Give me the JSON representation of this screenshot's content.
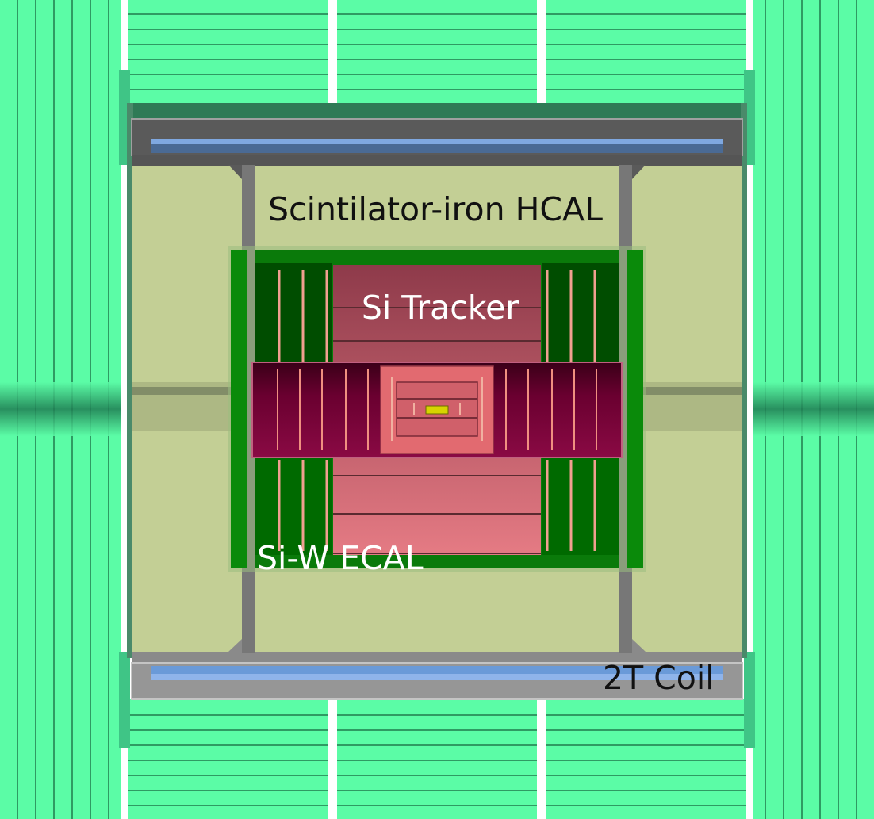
{
  "labels": {
    "hcal": "Scintilator-iron HCAL",
    "tracker": "Si Tracker",
    "ecal": "Si-W ECAL",
    "coil": "2T Coil"
  },
  "colors": {
    "muon": "#5bfca6",
    "muon_dark": "#2f9a63",
    "hcal": "#c3cf95",
    "ecal": "#007a00",
    "tracker": "#e57373",
    "coil_frame": "#6e6e6e",
    "coil": "#6b9bd6"
  }
}
